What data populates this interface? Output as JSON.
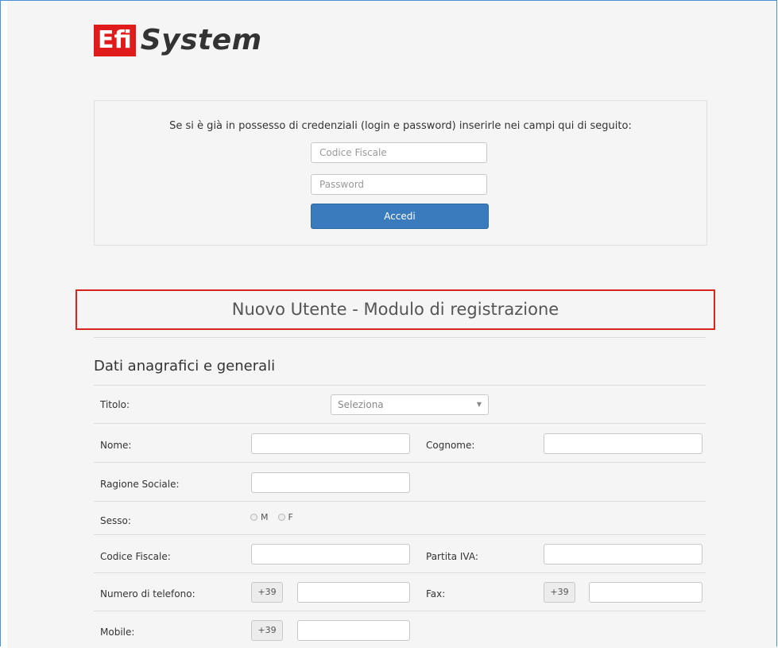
{
  "logo": {
    "part1": "Efi",
    "part2": "System"
  },
  "login": {
    "intro": "Se si è già in possesso di credenziali (login e password) inserirle nei campi qui di seguito:",
    "codice_placeholder": "Codice Fiscale",
    "password_placeholder": "Password",
    "button": "Accedi"
  },
  "registration": {
    "title": "Nuovo Utente - Modulo di registrazione",
    "section": "Dati anagrafici e generali",
    "fields": {
      "titolo": "Titolo:",
      "titolo_select": "Seleziona",
      "nome": "Nome:",
      "cognome": "Cognome:",
      "ragione_sociale": "Ragione Sociale:",
      "sesso": "Sesso:",
      "sesso_m": "M",
      "sesso_f": "F",
      "codice_fiscale": "Codice Fiscale:",
      "partita_iva": "Partita IVA:",
      "telefono": "Numero di telefono:",
      "telefono_prefix": "+39",
      "fax": "Fax:",
      "fax_prefix": "+39",
      "mobile": "Mobile:",
      "mobile_prefix": "+39"
    }
  },
  "colors": {
    "brand_red": "#e01b1b",
    "button_blue": "#3a7bbd",
    "highlight_red": "#d9261c"
  }
}
